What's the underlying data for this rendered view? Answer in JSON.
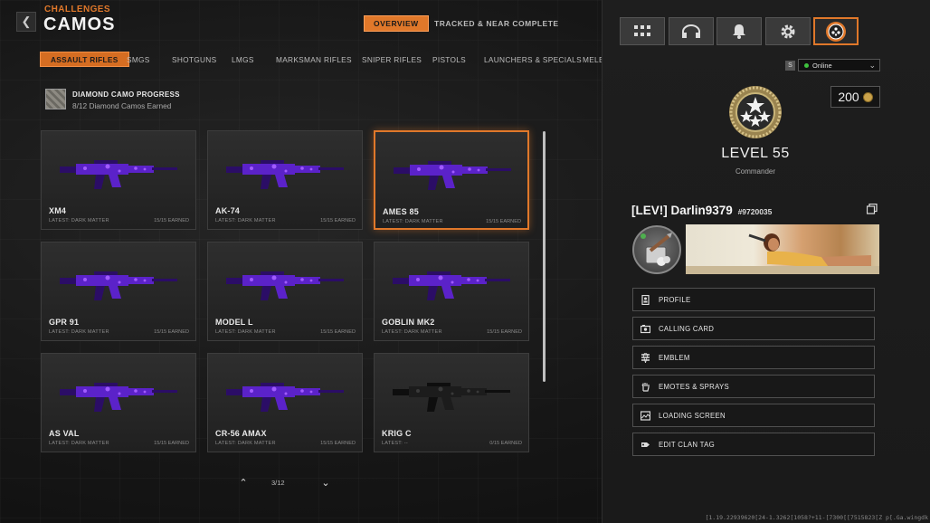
{
  "header": {
    "back_icon": "chevron-left-icon",
    "breadcrumb_parent": "CHALLENGES",
    "title": "CAMOS",
    "tabs": [
      {
        "label": "OVERVIEW",
        "active": true
      },
      {
        "label": "TRACKED & NEAR COMPLETE",
        "active": false
      }
    ]
  },
  "categories": [
    {
      "label": "ASSAULT RIFLES",
      "active": true
    },
    {
      "label": "SMGS"
    },
    {
      "label": "SHOTGUNS"
    },
    {
      "label": "LMGS"
    },
    {
      "label": "MARKSMAN RIFLES"
    },
    {
      "label": "SNIPER RIFLES"
    },
    {
      "label": "PISTOLS"
    },
    {
      "label": "LAUNCHERS & SPECIALS"
    },
    {
      "label": "MELEE"
    }
  ],
  "diamond_progress": {
    "title": "DIAMOND CAMO PROGRESS",
    "subtitle": "8/12 Diamond Camos Earned"
  },
  "weapons": [
    {
      "name": "XM4",
      "latest": "LATEST: DARK MATTER",
      "earned": "15/15 EARNED",
      "camo": "dark-matter"
    },
    {
      "name": "AK-74",
      "latest": "LATEST: DARK MATTER",
      "earned": "15/15 EARNED",
      "camo": "dark-matter"
    },
    {
      "name": "AMES 85",
      "latest": "LATEST: DARK MATTER",
      "earned": "15/15 EARNED",
      "camo": "dark-matter",
      "selected": true
    },
    {
      "name": "GPR 91",
      "latest": "LATEST: DARK MATTER",
      "earned": "15/15 EARNED",
      "camo": "dark-matter"
    },
    {
      "name": "MODEL L",
      "latest": "LATEST: DARK MATTER",
      "earned": "15/15 EARNED",
      "camo": "dark-matter"
    },
    {
      "name": "GOBLIN MK2",
      "latest": "LATEST: DARK MATTER",
      "earned": "15/15 EARNED",
      "camo": "dark-matter"
    },
    {
      "name": "AS VAL",
      "latest": "LATEST: DARK MATTER",
      "earned": "15/15 EARNED",
      "camo": "dark-matter"
    },
    {
      "name": "CR-56 AMAX",
      "latest": "LATEST: DARK MATTER",
      "earned": "15/15 EARNED",
      "camo": "dark-matter"
    },
    {
      "name": "KRIG C",
      "latest": "LATEST: --",
      "earned": "0/15 EARNED",
      "camo": "none"
    }
  ],
  "pager": {
    "text": "3/12",
    "up_icon": "chevron-up-icon",
    "down_icon": "chevron-down-icon"
  },
  "panel": {
    "tabs": [
      {
        "icon": "grid-icon"
      },
      {
        "icon": "headset-icon"
      },
      {
        "icon": "bell-icon"
      },
      {
        "icon": "gear-icon"
      },
      {
        "icon": "profile-rank-icon",
        "active": true
      }
    ],
    "status_prefix": "S",
    "status": "Online",
    "status_color": "#3ec23e",
    "cod_points": "200",
    "level": "LEVEL 55",
    "rank_name": "Commander",
    "player_name": "[LEV!] Darlin9379",
    "player_id": "#9720035",
    "menu": [
      {
        "label": "PROFILE",
        "icon": "profile-card-icon"
      },
      {
        "label": "CALLING CARD",
        "icon": "calling-card-icon"
      },
      {
        "label": "EMBLEM",
        "icon": "emblem-icon"
      },
      {
        "label": "EMOTES & SPRAYS",
        "icon": "emote-hand-icon"
      },
      {
        "label": "LOADING SCREEN",
        "icon": "loading-screen-icon"
      },
      {
        "label": "EDIT CLAN TAG",
        "icon": "clan-tag-icon"
      }
    ]
  },
  "footer_code": "[1.19.22939620[24-1.3262[1058?+11-[7300[[7515823[Z p[.Ga.wingdk",
  "colors": {
    "accent": "#e0782a",
    "camo_purple": "#6a2be0"
  }
}
